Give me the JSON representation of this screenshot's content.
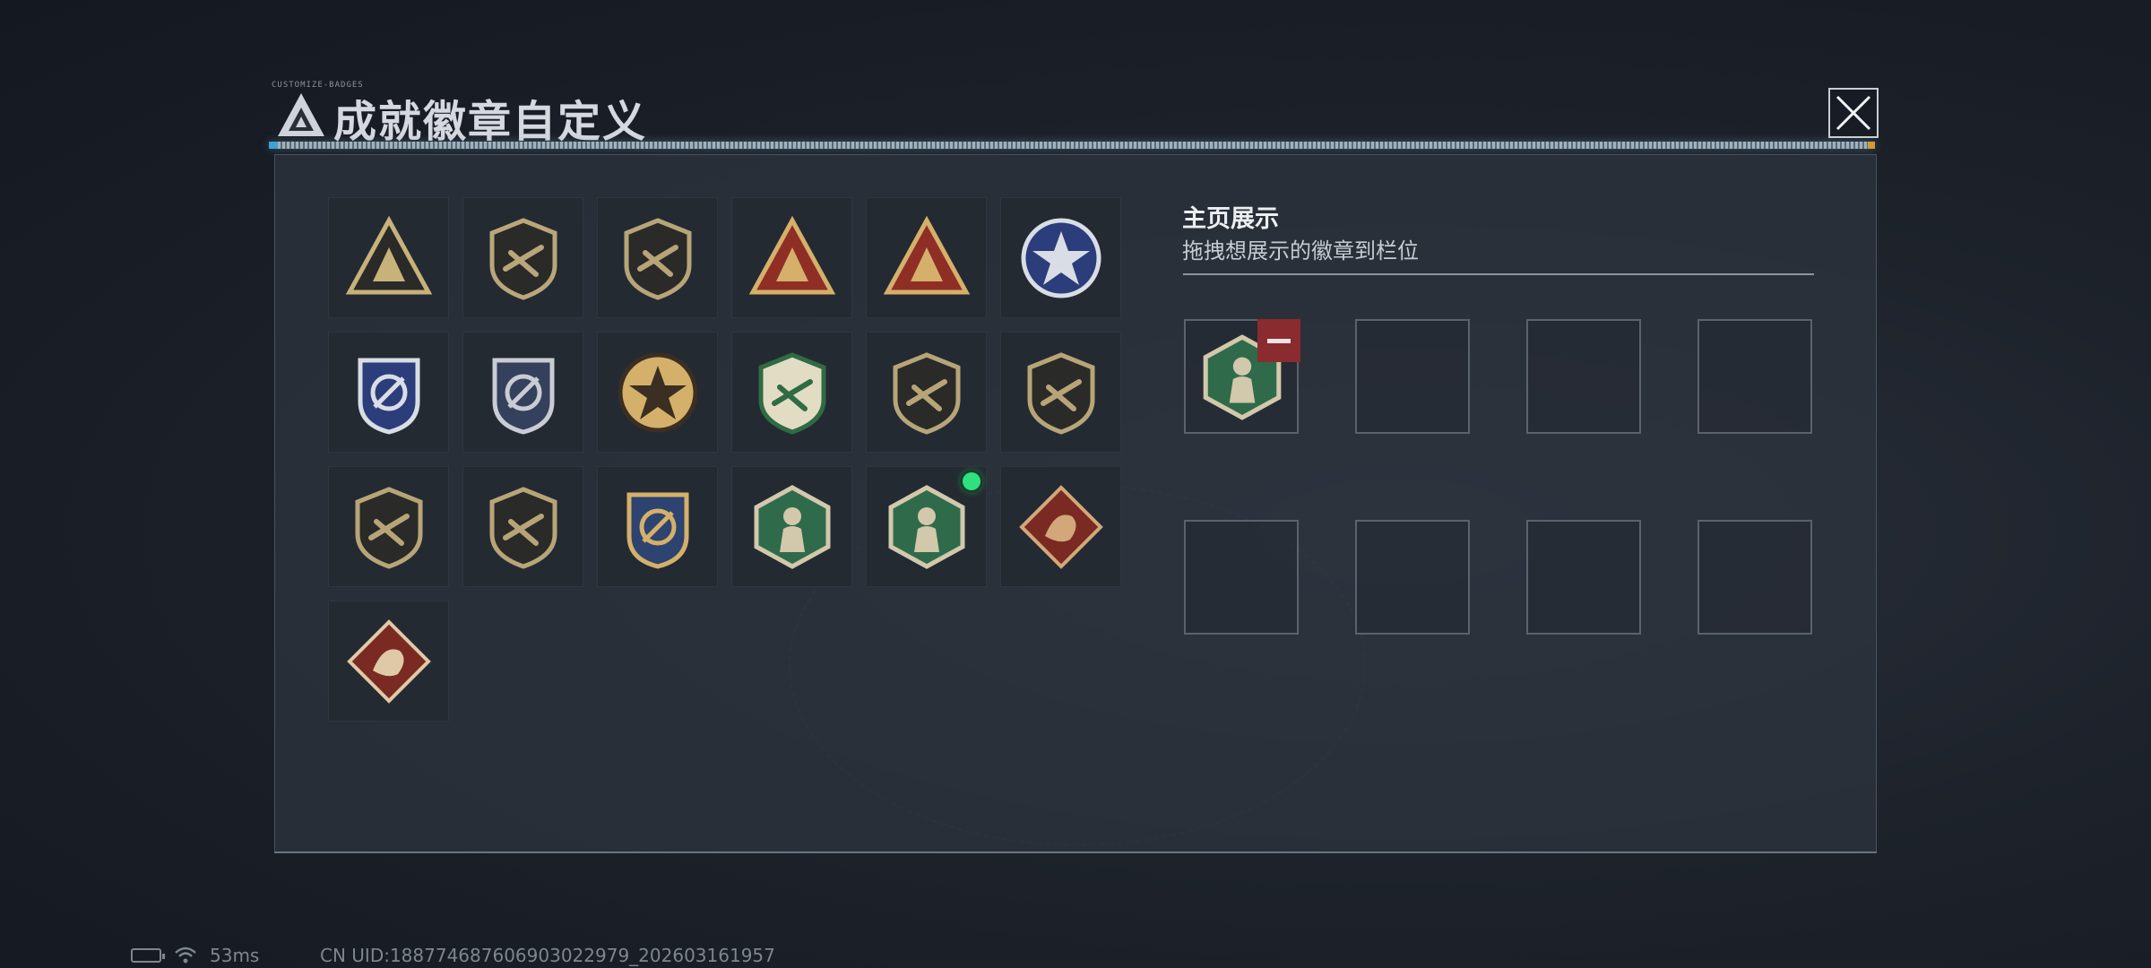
{
  "window": {
    "title": "成就徽章自定义",
    "tiny_label": "CUSTOMIZE-BADGES",
    "close_icon": "close-icon"
  },
  "badges": [
    {
      "icon": "triangle-shield-badge",
      "colors": [
        "#c7b27a",
        "#2a2a28"
      ]
    },
    {
      "icon": "helicopter-shield-badge",
      "colors": [
        "#b9a67a",
        "#2a2a28"
      ]
    },
    {
      "icon": "dagger-shield-badge",
      "colors": [
        "#b7a578",
        "#2a2a28"
      ]
    },
    {
      "icon": "rank-1-triangle-badge",
      "colors": [
        "#d4b06a",
        "#8e2e25"
      ]
    },
    {
      "icon": "soldiers-triangle-badge",
      "colors": [
        "#d4b06a",
        "#8e2e25"
      ]
    },
    {
      "icon": "star-round-badge",
      "colors": [
        "#2b3d7a",
        "#d9dde5"
      ]
    },
    {
      "icon": "blue-crest-badge",
      "colors": [
        "#2b3d7a",
        "#d9dde5"
      ]
    },
    {
      "icon": "skull-crest-badge",
      "colors": [
        "#34405c",
        "#c9ccd3"
      ]
    },
    {
      "icon": "tank-sunburst-badge",
      "colors": [
        "#d4b06a",
        "#3a2f22"
      ]
    },
    {
      "icon": "green-rifle-shield-badge",
      "colors": [
        "#2f6b43",
        "#e3dcc4"
      ]
    },
    {
      "icon": "rifle-shield-badge",
      "colors": [
        "#b7a578",
        "#2a2a28"
      ]
    },
    {
      "icon": "rifle-shield-badge",
      "colors": [
        "#b7a578",
        "#2a2a28"
      ]
    },
    {
      "icon": "rifle-shield-badge",
      "colors": [
        "#b7a578",
        "#2a2a28"
      ]
    },
    {
      "icon": "rifle-shield-badge",
      "colors": [
        "#b7a578",
        "#2a2a28"
      ]
    },
    {
      "icon": "gold-rifle-crest-badge",
      "colors": [
        "#2d4370",
        "#d4b06a"
      ]
    },
    {
      "icon": "insect-hexagon-badge",
      "colors": [
        "#2f6b4a",
        "#d2c8ab"
      ]
    },
    {
      "icon": "soldier-hexagon-badge",
      "colors": [
        "#2f6b4a",
        "#d2c8ab"
      ],
      "new": true
    },
    {
      "icon": "dragon-diamond-badge",
      "colors": [
        "#7a2a22",
        "#d2a77a"
      ]
    },
    {
      "icon": "runner-diamond-badge",
      "colors": [
        "#7a2a22",
        "#e0c9a6"
      ]
    }
  ],
  "showcase": {
    "title": "主页展示",
    "subtitle": "拖拽想展示的徽章到栏位",
    "slots": [
      {
        "filled": true,
        "icon": "soldier-hexagon-badge",
        "remove_icon": "minus-icon"
      },
      {
        "filled": false
      },
      {
        "filled": false
      },
      {
        "filled": false
      },
      {
        "filled": false
      },
      {
        "filled": false
      },
      {
        "filled": false
      },
      {
        "filled": false
      }
    ]
  },
  "status": {
    "battery_icon": "battery-charging-icon",
    "wifi_icon": "wifi-icon",
    "ping": "53ms",
    "uid": "CN UID:188774687606903022979_202603161957"
  }
}
